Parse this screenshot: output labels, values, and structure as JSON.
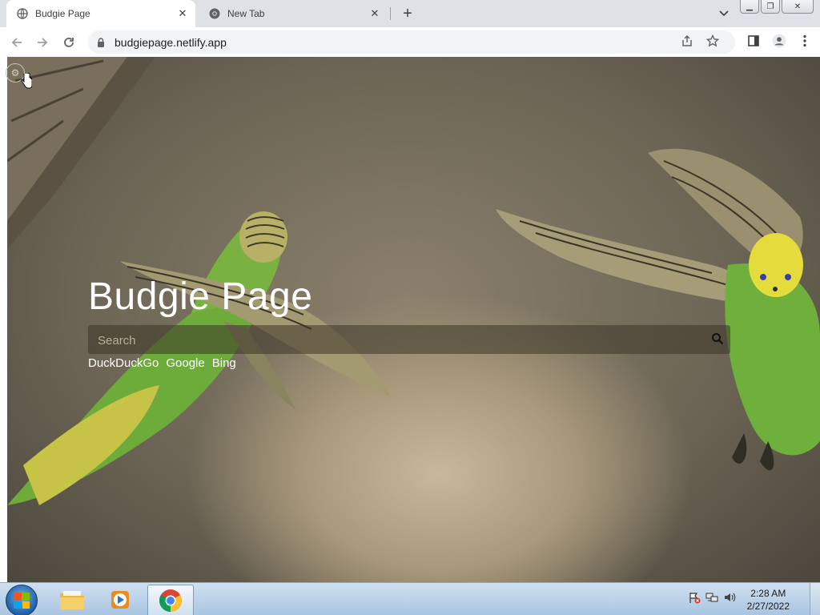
{
  "browser": {
    "tabs": [
      {
        "title": "Budgie Page",
        "active": true
      },
      {
        "title": "New Tab",
        "active": false
      }
    ],
    "address": "budgiepage.netlify.app"
  },
  "page": {
    "title": "Budgie Page",
    "search_placeholder": "Search",
    "engines": [
      "DuckDuckGo",
      "Google",
      "Bing"
    ]
  },
  "taskbar": {
    "time": "2:28 AM",
    "date": "2/27/2022",
    "apps": [
      "windows-explorer",
      "media-player",
      "chrome"
    ]
  },
  "colors": {
    "tabstrip": "#dee1e6",
    "taskbar": "#bcd2ea",
    "hero_text": "#ffffff"
  }
}
